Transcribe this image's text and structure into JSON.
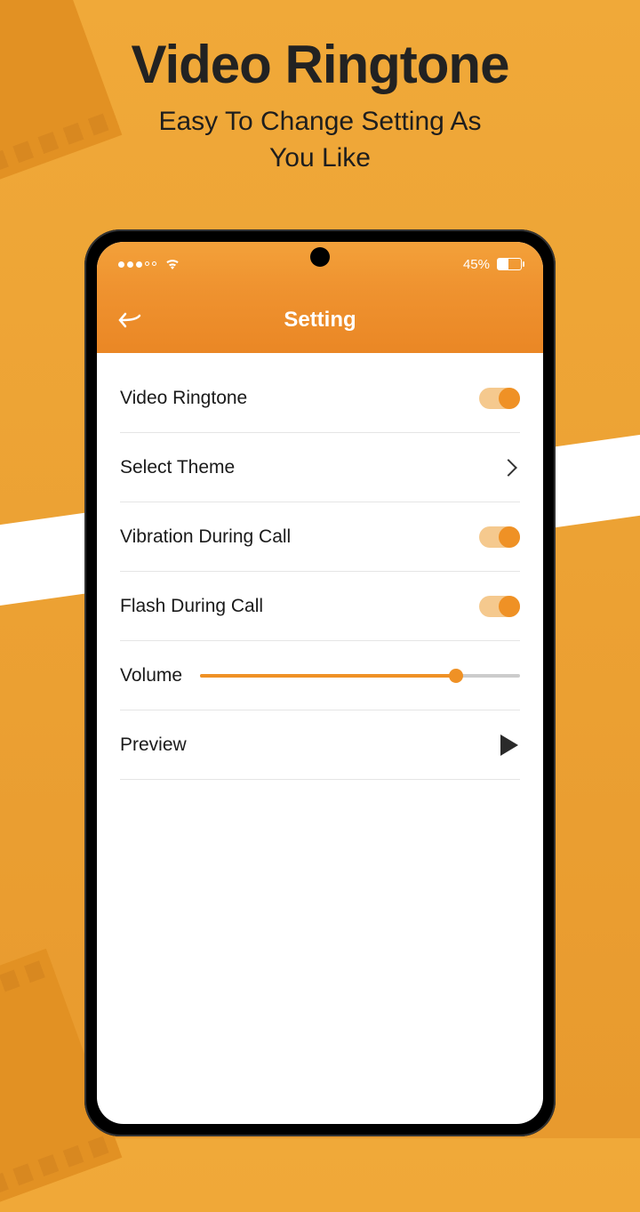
{
  "hero": {
    "title": "Video Ringtone",
    "subtitle_line1": "Easy To Change Setting As",
    "subtitle_line2": "You Like"
  },
  "statusbar": {
    "battery_pct": "45%"
  },
  "header": {
    "title": "Setting"
  },
  "settings": {
    "items": [
      {
        "label": "Video Ringtone",
        "type": "toggle",
        "on": true
      },
      {
        "label": "Select Theme",
        "type": "nav"
      },
      {
        "label": "Vibration During Call",
        "type": "toggle",
        "on": true
      },
      {
        "label": "Flash During Call",
        "type": "toggle",
        "on": true
      },
      {
        "label": "Volume",
        "type": "slider",
        "value": 80
      },
      {
        "label": "Preview",
        "type": "play"
      }
    ]
  },
  "colors": {
    "accent": "#ef9125",
    "bg_top": "#f0a939"
  }
}
